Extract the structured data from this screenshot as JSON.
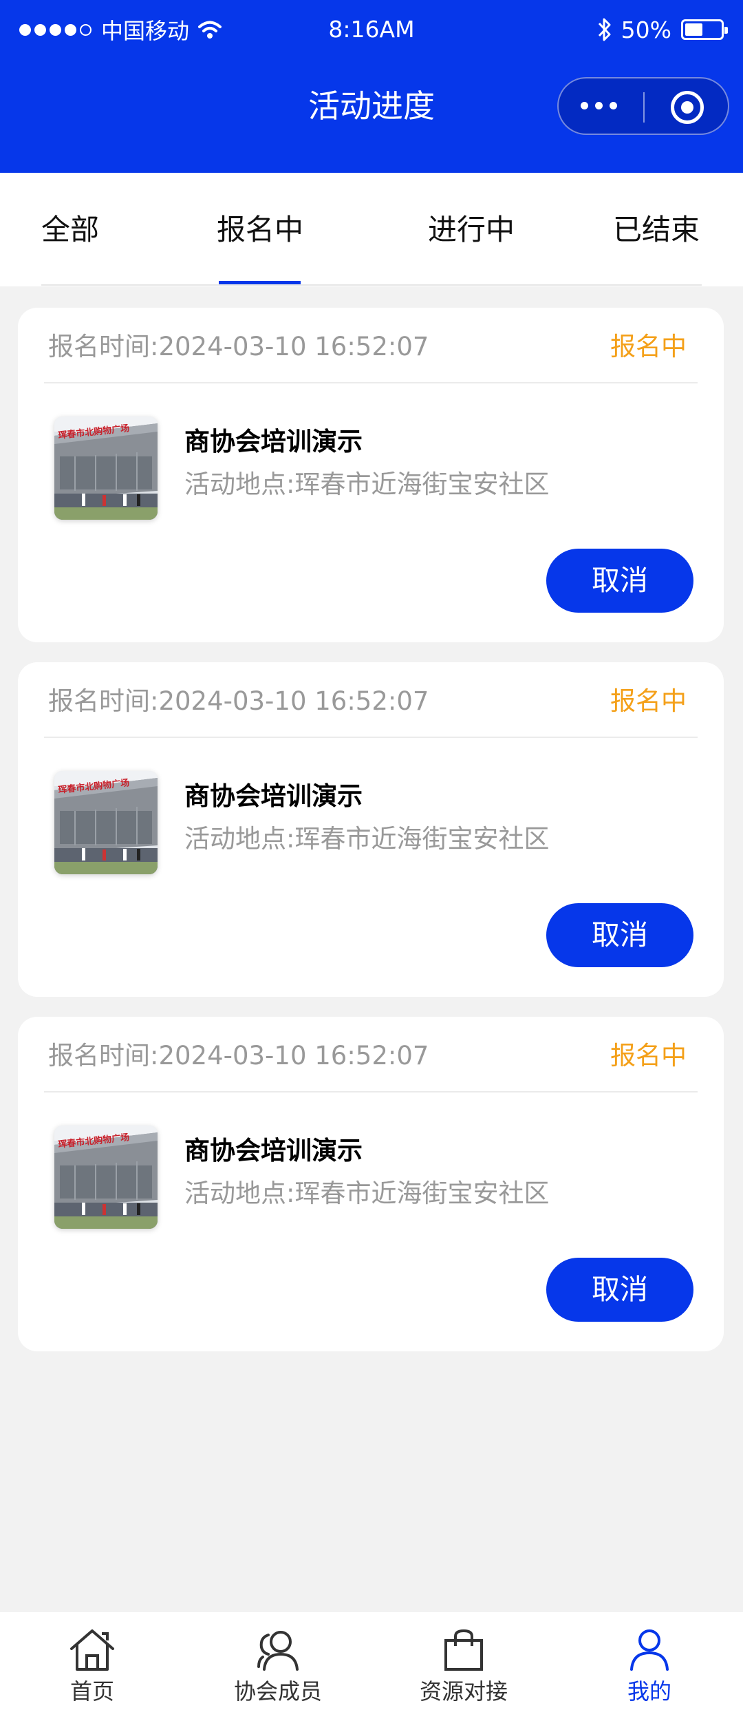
{
  "status_bar": {
    "carrier": "中国移动",
    "time": "8:16AM",
    "battery": "50%",
    "battery_level": 0.5
  },
  "nav": {
    "title": "活动进度"
  },
  "tabs": [
    {
      "label": "全部",
      "active": false
    },
    {
      "label": "报名中",
      "active": true
    },
    {
      "label": "进行中",
      "active": false
    },
    {
      "label": "已结束",
      "active": false
    }
  ],
  "cards": [
    {
      "time": "报名时间:2024-03-10 16:52:07",
      "status": "报名中",
      "title": "商协会培训演示",
      "address": "活动地点:珲春市近海街宝安社区",
      "button": "取消",
      "thumbnail_sign": "珲春市北购物广场"
    },
    {
      "time": "报名时间:2024-03-10 16:52:07",
      "status": "报名中",
      "title": "商协会培训演示",
      "address": "活动地点:珲春市近海街宝安社区",
      "button": "取消",
      "thumbnail_sign": "珲春市北购物广场"
    },
    {
      "time": "报名时间:2024-03-10 16:52:07",
      "status": "报名中",
      "title": "商协会培训演示",
      "address": "活动地点:珲春市近海街宝安社区",
      "button": "取消",
      "thumbnail_sign": "珲春市北购物广场"
    }
  ],
  "bottom_nav": [
    {
      "label": "首页",
      "icon": "home-icon",
      "active": false
    },
    {
      "label": "协会成员",
      "icon": "members-icon",
      "active": false
    },
    {
      "label": "资源对接",
      "icon": "shopping-bag-icon",
      "active": false
    },
    {
      "label": "我的",
      "icon": "profile-icon",
      "active": true
    }
  ],
  "colors": {
    "primary": "#0637ea",
    "status_orange": "#f4a019",
    "muted_text": "#999999",
    "background": "#f2f2f2"
  }
}
